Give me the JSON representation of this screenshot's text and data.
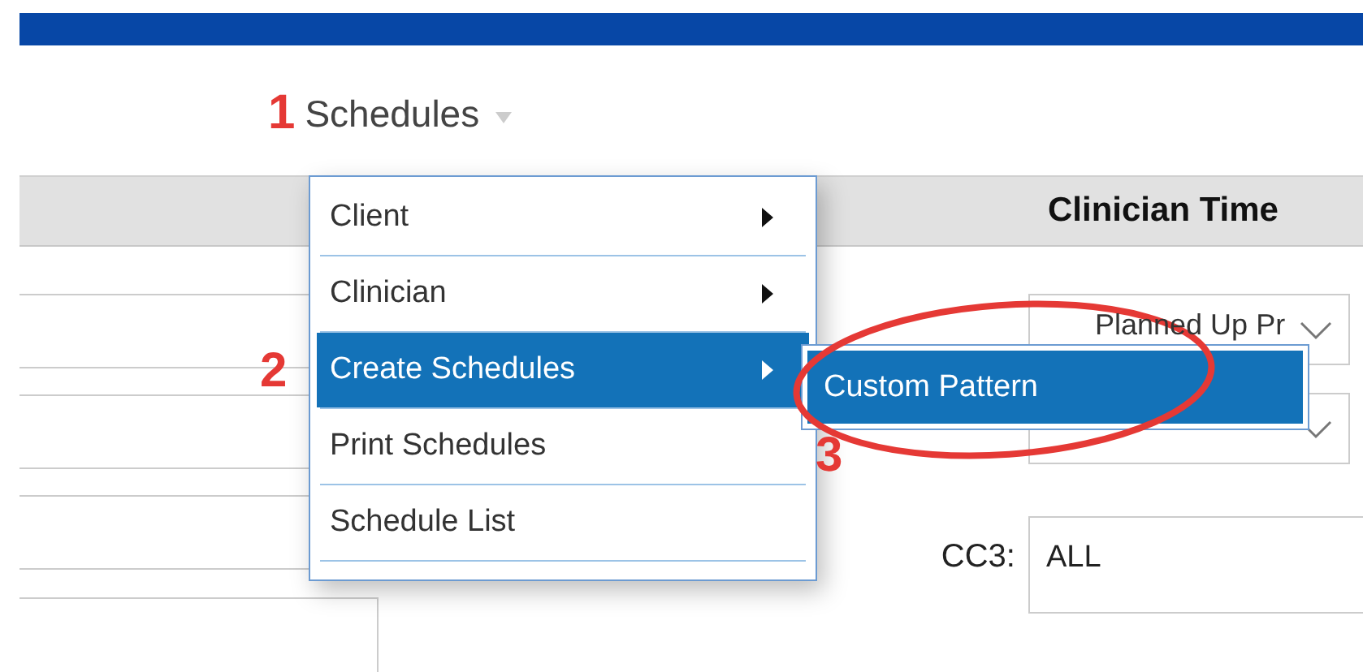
{
  "nav": {
    "annotation": "1",
    "label": "Schedules"
  },
  "menu": {
    "items": [
      {
        "label": "Client",
        "has_submenu": true,
        "selected": false
      },
      {
        "label": "Clinician",
        "has_submenu": true,
        "selected": false
      },
      {
        "label": "Create Schedules",
        "has_submenu": true,
        "selected": true,
        "annotation": "2"
      },
      {
        "label": "Print Schedules",
        "has_submenu": false,
        "selected": false
      },
      {
        "label": "Schedule List",
        "has_submenu": false,
        "selected": false
      }
    ]
  },
  "submenu": {
    "items": [
      {
        "label": "Custom Pattern",
        "selected": true,
        "annotation": "3"
      }
    ]
  },
  "panel": {
    "title": "Clinician Time"
  },
  "form": {
    "status_value": "Planned Up Pr",
    "cc3_label": "CC3:",
    "cc3_value": "ALL"
  }
}
